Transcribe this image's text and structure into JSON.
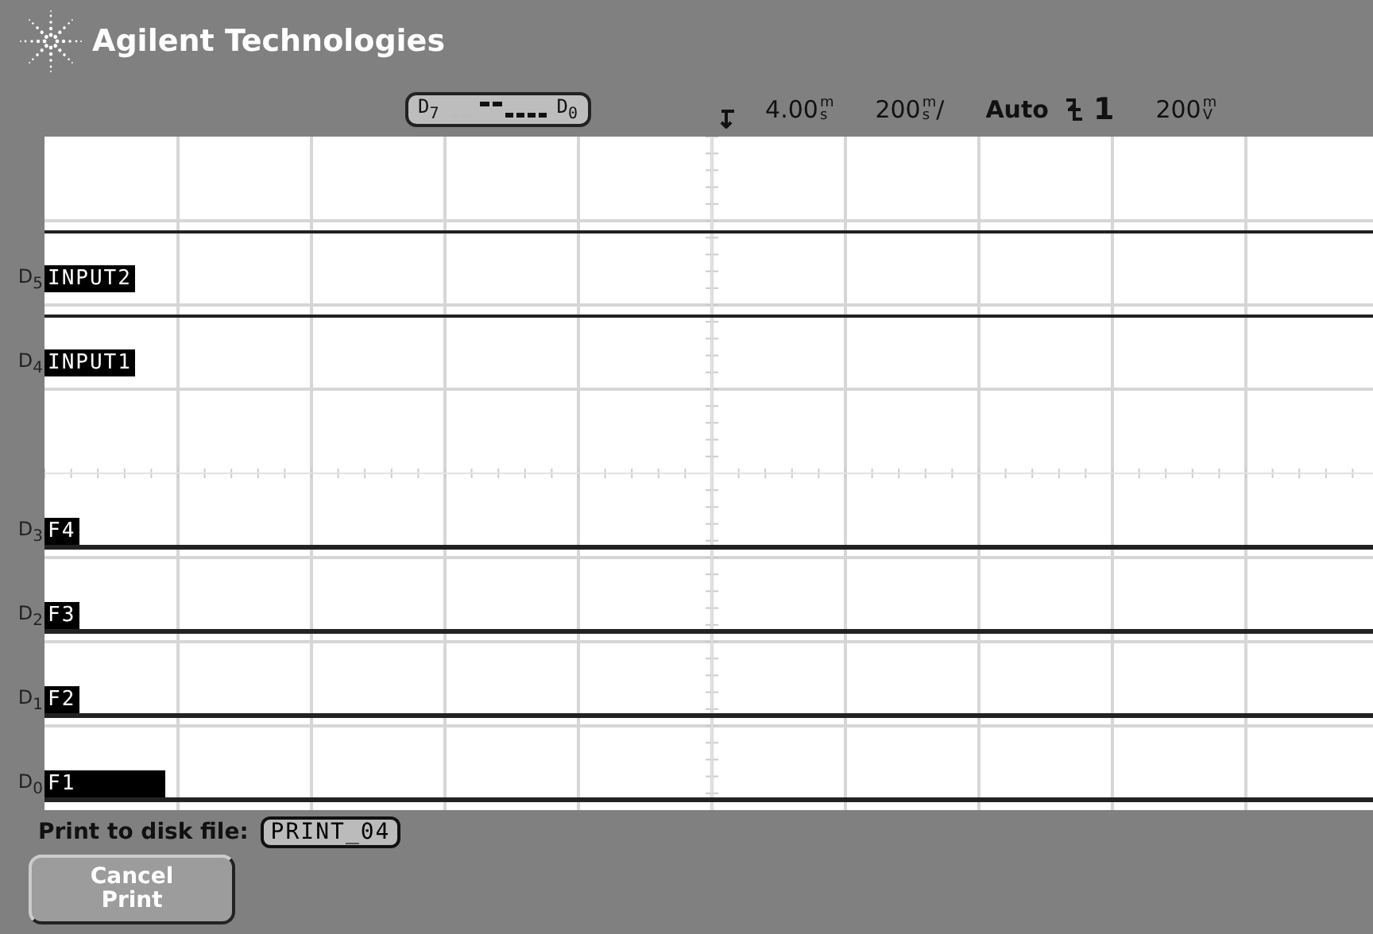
{
  "header": {
    "title": "Agilent Technologies"
  },
  "status_line": {
    "activity": {
      "high_label": "D$_{7}$",
      "low_label": "D$_{0}$"
    },
    "delay": {
      "value": "4.00",
      "unit_top": "m",
      "unit_bottom": "s"
    },
    "timebase": {
      "value": "200",
      "unit_top": "m",
      "unit_bottom": "s",
      "suffix": "/"
    },
    "trigger_mode": "Auto",
    "trigger_source": "1",
    "threshold": {
      "value": "200",
      "unit_top": "m",
      "unit_bottom": "V"
    }
  },
  "channels": [
    {
      "bit": "D$_{5}$",
      "label": "INPUT2",
      "high": true
    },
    {
      "bit": "D$_{4}$",
      "label": "INPUT1",
      "high": true
    },
    {
      "bit": "D$_{3}$",
      "label": "F4",
      "high": false
    },
    {
      "bit": "D$_{2}$",
      "label": "F3",
      "high": false
    },
    {
      "bit": "D$_{1}$",
      "label": "F2",
      "high": false
    },
    {
      "bit": "D$_{0}$",
      "label": "F1",
      "high": false
    }
  ],
  "print": {
    "label": "Print to disk file:",
    "filename": "PRINT_04"
  },
  "buttons": [
    {
      "label": "Cancel Print",
      "disabled": true
    }
  ]
}
